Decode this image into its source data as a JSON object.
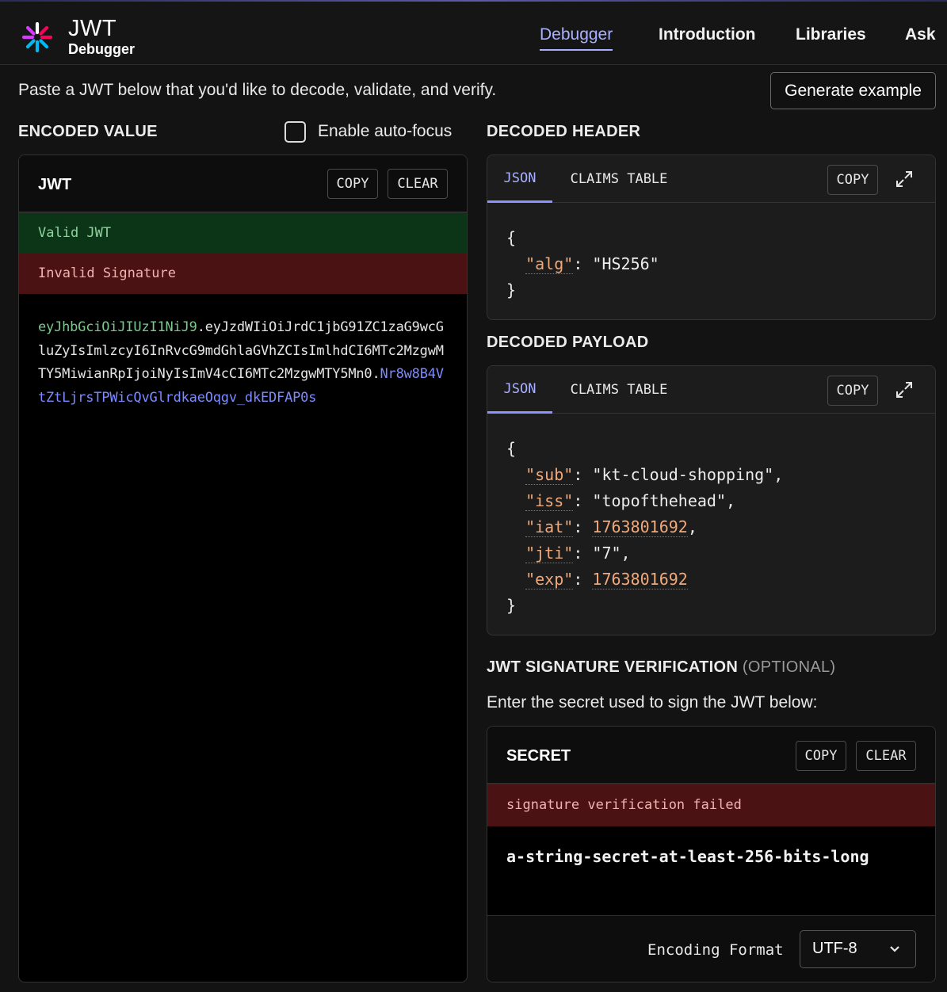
{
  "nav": {
    "brand_title": "JWT",
    "brand_sub": "Debugger",
    "links": [
      "Debugger",
      "Introduction",
      "Libraries",
      "Ask"
    ]
  },
  "intro": {
    "text": "Paste a JWT below that you'd like to decode, validate, and verify.",
    "generate_label": "Generate example"
  },
  "encoded": {
    "section_title": "ENCODED VALUE",
    "autofocus_label": "Enable auto-focus",
    "panel_title": "JWT",
    "copy_label": "COPY",
    "clear_label": "CLEAR",
    "valid_text": "Valid JWT",
    "invalid_text": "Invalid Signature",
    "token_header": "eyJhbGciOiJIUzI1NiJ9",
    "token_payload": "eyJzdWIiOiJrdC1jbG91ZC1zaG9wcGluZyIsImlzcyI6InRvcG9mdGhlaGVhZCIsImlhdCI6MTc2MzgwMTY5MiwianRpIjoiNyIsImV4cCI6MTc2MzgwMTY5Mn0",
    "token_signature": "Nr8w8B4VtZtLjrsTPWicQvGlrdkaeOqgv_dkEDFAP0s",
    "dot": "."
  },
  "header": {
    "section_title": "DECODED HEADER",
    "tab_json": "JSON",
    "tab_claims": "CLAIMS TABLE",
    "copy_label": "COPY",
    "open": "{",
    "close": "}",
    "key_alg": "\"alg\"",
    "val_alg": "\"HS256\""
  },
  "payload": {
    "section_title": "DECODED PAYLOAD",
    "tab_json": "JSON",
    "tab_claims": "CLAIMS TABLE",
    "copy_label": "COPY",
    "open": "{",
    "close": "}",
    "key_sub": "\"sub\"",
    "val_sub": "\"kt-cloud-shopping\"",
    "key_iss": "\"iss\"",
    "val_iss": "\"topofthehead\"",
    "key_iat": "\"iat\"",
    "val_iat": "1763801692",
    "key_jti": "\"jti\"",
    "val_jti": "\"7\"",
    "key_exp": "\"exp\"",
    "val_exp": "1763801692"
  },
  "signature": {
    "section_title": "JWT SIGNATURE VERIFICATION",
    "optional": "(OPTIONAL)",
    "enter_label": "Enter the secret used to sign the JWT below:",
    "panel_title": "SECRET",
    "copy_label": "COPY",
    "clear_label": "CLEAR",
    "status": "signature verification failed",
    "secret_value": "a-string-secret-at-least-256-bits-long",
    "encoding_label": "Encoding Format",
    "encoding_value": "UTF-8"
  },
  "colors": {
    "accent": "#a9b0ff",
    "valid_bg": "#0b3516",
    "invalid_bg": "#4a1212",
    "json_key": "#f0a97a"
  }
}
